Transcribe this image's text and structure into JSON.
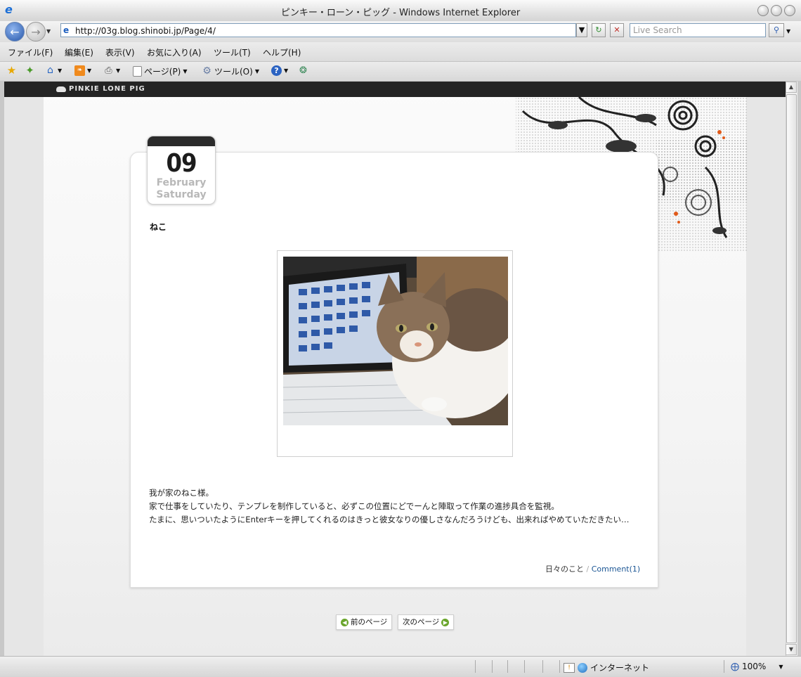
{
  "window": {
    "title": "ピンキー・ローン・ピッグ - Windows Internet Explorer"
  },
  "navbar": {
    "back_icon": "back-arrow-icon",
    "forward_icon": "forward-arrow-icon",
    "address": "http://03g.blog.shinobi.jp/Page/4/",
    "search_placeholder": "Live Search"
  },
  "menu": [
    {
      "label": "ファイル(F)"
    },
    {
      "label": "編集(E)"
    },
    {
      "label": "表示(V)"
    },
    {
      "label": "お気に入り(A)"
    },
    {
      "label": "ツール(T)"
    },
    {
      "label": "ヘルプ(H)"
    }
  ],
  "toolbar": {
    "page_label": "ページ(P)",
    "tools_label": "ツール(O)"
  },
  "site": {
    "logo": "PINKIE LONE PIG"
  },
  "post": {
    "day": "09",
    "month": "February",
    "weekday": "Saturday",
    "title": "ねこ",
    "body": [
      "我が家のねこ様。",
      "家で仕事をしていたり、テンプレを制作していると、必ずこの位置にどでーんと陣取って作業の進捗具合を監視。",
      "たまに、思いついたようにEnterキーを押してくれるのはきっと彼女なりの優しさなんだろうけども、出来ればやめていただきたい…"
    ],
    "category": "日々のこと",
    "separator": "/",
    "comment_link": "Comment(1)"
  },
  "pager": {
    "prev": "前のページ",
    "next": "次のページ"
  },
  "status": {
    "zone": "インターネット",
    "zoom": "100%"
  },
  "colors": {
    "header_bg": "#242424",
    "link": "#1d5795",
    "pager_green": "#6aa52c"
  }
}
